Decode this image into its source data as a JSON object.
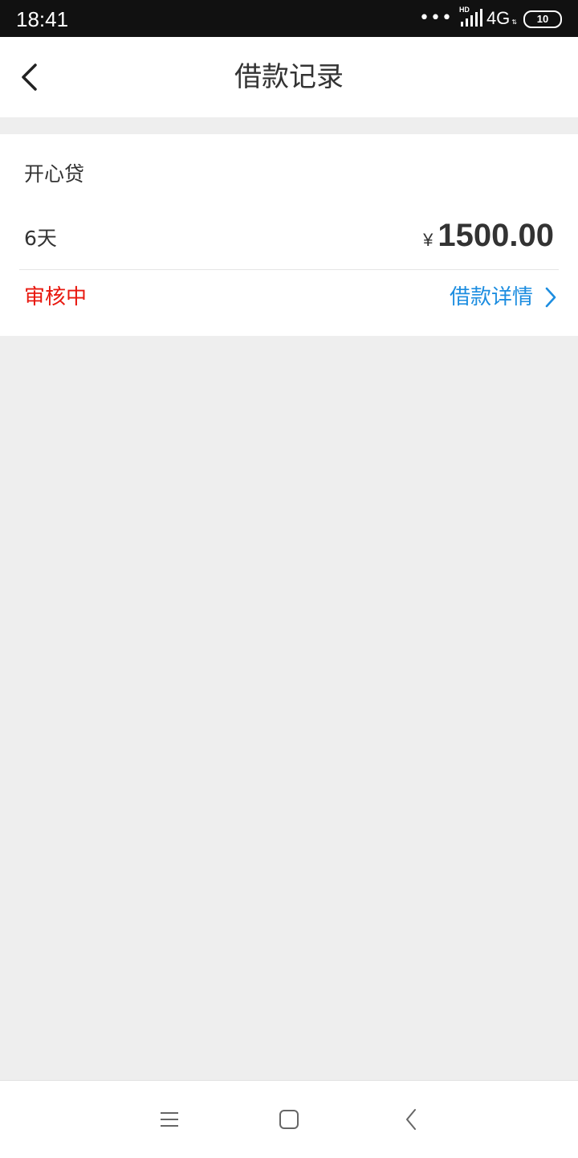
{
  "status_bar": {
    "time": "18:41",
    "signal_label": "HD",
    "network": "4G",
    "battery": "10"
  },
  "header": {
    "title": "借款记录",
    "back_icon": "chevron-left-icon"
  },
  "loan_record": {
    "product_name": "开心贷",
    "term": "6天",
    "currency_symbol": "¥",
    "amount": "1500.00",
    "status": "审核中",
    "detail_link": "借款详情"
  },
  "colors": {
    "status_red": "#e8180f",
    "link_blue": "#1c8de0",
    "text_dark": "#333333",
    "background_gray": "#eeeeee"
  },
  "nav_bar": {
    "icons": [
      "menu-icon",
      "home-square-icon",
      "back-triangle-icon"
    ]
  }
}
